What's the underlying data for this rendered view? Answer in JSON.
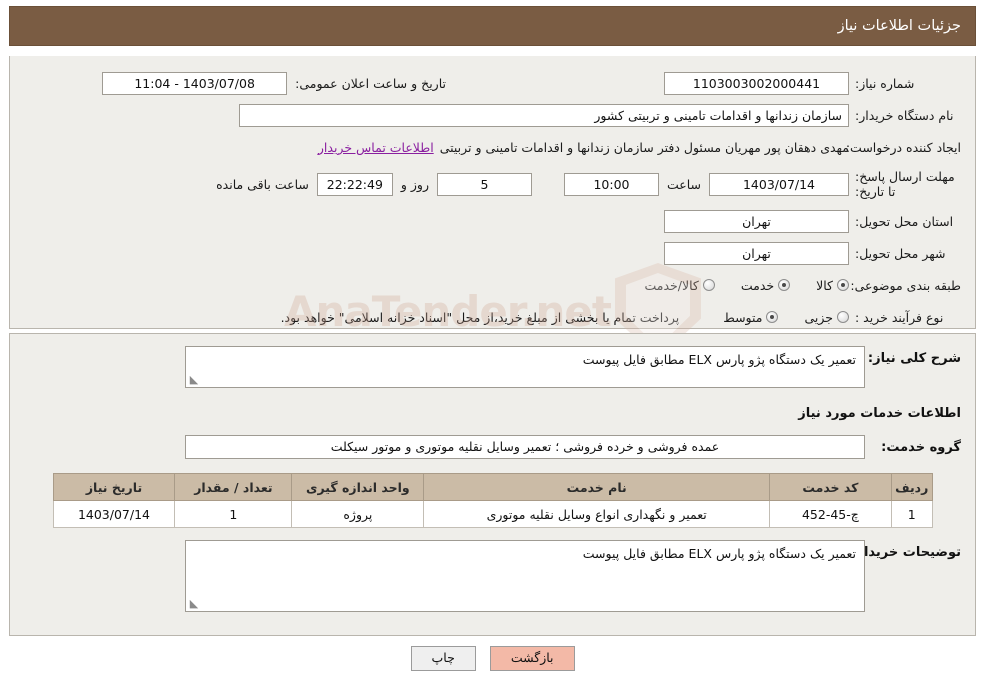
{
  "header": {
    "title": "جزئیات اطلاعات نیاز"
  },
  "form": {
    "need_number_label": "شماره نیاز:",
    "need_number_value": "1103003002000441",
    "announce_datetime_label": "تاریخ و ساعت اعلان عمومی:",
    "announce_datetime_value": "1403/07/08 - 11:04",
    "buyer_org_label": "نام دستگاه خریدار:",
    "buyer_org_value": "سازمان زندانها و اقدامات تامینی و تربیتی کشور",
    "requester_label": "ایجاد کننده درخواست:",
    "requester_value": "مهدی  دهقان پور مهریان مسئول دفتر سازمان زندانها و اقدامات تامینی و تربیتی",
    "contact_link": "اطلاعات تماس خریدار",
    "deadline_label": "مهلت ارسال پاسخ: تا تاریخ:",
    "deadline_date": "1403/07/14",
    "deadline_time_label": "ساعت",
    "deadline_time": "10:00",
    "days_value": "5",
    "days_label": "روز و",
    "countdown_value": "22:22:49",
    "countdown_label": "ساعت باقی مانده",
    "province_label": "استان محل تحویل:",
    "province_value": "تهران",
    "city_label": "شهر محل تحویل:",
    "city_value": "تهران",
    "category_label": "طبقه بندی موضوعی:",
    "category_options": [
      {
        "label": "کالا",
        "selected": true
      },
      {
        "label": "خدمت",
        "selected": true
      },
      {
        "label": "کالا/خدمت",
        "selected": false
      }
    ],
    "process_type_label": "نوع فرآیند خرید :",
    "process_type_options": [
      {
        "label": "جزیی",
        "selected": false
      },
      {
        "label": "متوسط",
        "selected": true
      }
    ],
    "payment_note": "پرداخت تمام یا بخشی از مبلغ خرید،از محل \"اسناد خزانه اسلامی\" خواهد بود."
  },
  "watermark": {
    "text": "AnaTender.net"
  },
  "lower": {
    "general_desc_label": "شرح کلی نیاز:",
    "general_desc_value": "تعمیر یک دستگاه پژو پارس ELX مطابق فایل پیوست",
    "services_heading": "اطلاعات خدمات مورد نیاز",
    "service_group_label": "گروه خدمت:",
    "service_group_value": "عمده فروشی و خرده فروشی ؛ تعمیر وسایل نقلیه موتوری و موتور سیکلت",
    "table": {
      "columns": [
        "ردیف",
        "کد خدمت",
        "نام خدمت",
        "واحد اندازه گیری",
        "تعداد / مقدار",
        "تاریخ نیاز"
      ],
      "rows": [
        {
          "index": "1",
          "service_code": "چ-45-452",
          "service_name": "تعمیر و نگهداری انواع وسایل نقلیه موتوری",
          "unit": "پروژه",
          "quantity": "1",
          "need_date": "1403/07/14"
        }
      ]
    },
    "buyer_notes_label": "توضیحات خریدار:",
    "buyer_notes_value": "تعمیر یک دستگاه پژو پارس ELX مطابق فایل پیوست"
  },
  "footer": {
    "print_label": "چاپ",
    "back_label": "بازگشت"
  }
}
